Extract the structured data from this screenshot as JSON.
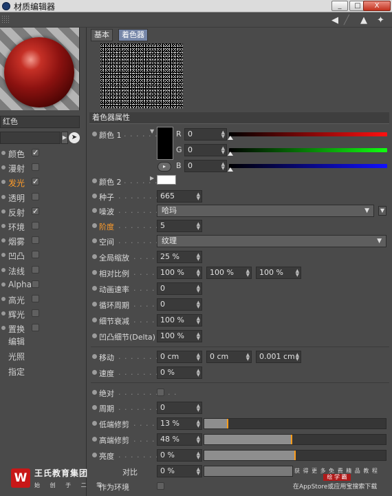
{
  "window": {
    "title": "材质编辑器",
    "buttons": {
      "minimize": "_",
      "maximize": "□",
      "close": "X"
    }
  },
  "toolbar": {
    "icons": [
      "arrow-left-icon",
      "arrow-right-icon",
      "arrow-up-icon",
      "pin-icon"
    ]
  },
  "left": {
    "material_name": "红色",
    "channels": [
      {
        "label": "颜色",
        "checked": true
      },
      {
        "label": "漫射",
        "checked": false
      },
      {
        "label": "发光",
        "checked": true,
        "active": true
      },
      {
        "label": "透明",
        "checked": false
      },
      {
        "label": "反射",
        "checked": true
      },
      {
        "label": "环境",
        "checked": false
      },
      {
        "label": "烟雾",
        "checked": false
      },
      {
        "label": "凹凸",
        "checked": false
      },
      {
        "label": "法线",
        "checked": false
      },
      {
        "label": "Alpha",
        "checked": false
      },
      {
        "label": "高光",
        "checked": false
      },
      {
        "label": "辉光",
        "checked": false
      },
      {
        "label": "置换",
        "checked": false
      }
    ],
    "sub_items": [
      "编辑",
      "光照",
      "指定"
    ],
    "checkmark": "✓"
  },
  "tabs": [
    "基本",
    "着色器"
  ],
  "section": {
    "title": "着色器属性"
  },
  "color1": {
    "label": "颜色 1",
    "dots": ". . . . . .",
    "swatch": "#000000",
    "channels": [
      {
        "name": "R",
        "value": "0"
      },
      {
        "name": "G",
        "value": "0"
      },
      {
        "name": "B",
        "value": "0"
      }
    ]
  },
  "color2": {
    "label": "颜色 2",
    "dots": ". . . . . .",
    "swatch": "#ffffff"
  },
  "props": {
    "seed": {
      "label": "种子",
      "dots": ". . . . . . . . .",
      "value": "665"
    },
    "noise": {
      "label": "噪波",
      "dots": ". . . . . . . . .",
      "value": "哈玛"
    },
    "octaves": {
      "label": "阶度",
      "dots": ". . . . . . . . .",
      "value": "5"
    },
    "space": {
      "label": "空间",
      "dots": ". . . . . . . . .",
      "value": "纹理"
    },
    "global_scale": {
      "label": "全局缩放",
      "dots": ". . . . . .",
      "value": "25 %"
    },
    "relative_scale": {
      "label": "相对比例",
      "dots": ". . . . . .",
      "values": [
        "100 %",
        "100 %",
        "100 %"
      ]
    },
    "anim_speed": {
      "label": "动画速率",
      "dots": ". . . . . .",
      "value": "0"
    },
    "loop_period": {
      "label": "循环周期",
      "dots": ". . . . . .",
      "value": "0"
    },
    "detail_atten": {
      "label": "细节衰减",
      "dots": ". . . . . .",
      "value": "100 %"
    },
    "bump_detail": {
      "label": "凹凸细节(Delta)",
      "value": "100 %"
    },
    "move": {
      "label": "移动",
      "dots": ". . . . . . . . . .",
      "values": [
        "0 cm",
        "0 cm",
        "0.001 cm"
      ]
    },
    "speed": {
      "label": "速度",
      "dots": ". . . . . . . . . .",
      "value": "0 %"
    },
    "absolute": {
      "label": "绝对",
      "dots": ". . . . . . . . . .",
      "checked": false
    },
    "period": {
      "label": "周期",
      "dots": ". . . . . . . . . .",
      "value": "0"
    },
    "low_clip": {
      "label": "低端修剪",
      "dots": ". . . . . .",
      "value": "13 %",
      "fraction": 0.13
    },
    "high_clip": {
      "label": "高端修剪",
      "dots": ". . . . . .",
      "value": "48 %",
      "fraction": 0.48
    },
    "brightness": {
      "label": "亮度",
      "dots": ". . . . . . . . .",
      "value": "0 %",
      "fraction": 0.5
    },
    "contrast": {
      "label": "对比",
      "value": "0 %"
    },
    "use_as_env": {
      "label": "作为环境"
    }
  },
  "overlay": {
    "logo_glyph": "W",
    "company": "王氏教育集团",
    "tagline": "始 创 于 二 零",
    "wm_line1": "获 得 更 多 免 费 精 品 教 程",
    "wm_badge": "绘 学 霸",
    "wm_line3": "在AppStore或应用宝搜索下载"
  },
  "colors": {
    "accent": "#ff9c2a",
    "panel": "#4a4a4a",
    "field": "#3a3a3a",
    "tab_active": "#7686a8"
  }
}
